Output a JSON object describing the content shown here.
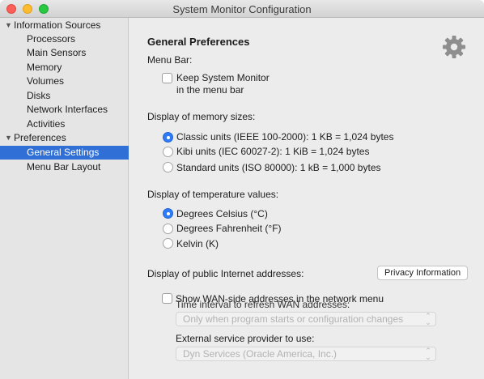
{
  "window": {
    "title": "System Monitor Configuration"
  },
  "sidebar": {
    "groups": [
      {
        "label": "Information Sources",
        "items": [
          "Processors",
          "Main Sensors",
          "Memory",
          "Volumes",
          "Disks",
          "Network Interfaces",
          "Activities"
        ]
      },
      {
        "label": "Preferences",
        "items": [
          "General Settings",
          "Menu Bar Layout"
        ]
      }
    ],
    "selected": "General Settings",
    "disclosure_icon": "disclosure-triangle-down"
  },
  "content": {
    "heading": "General Preferences",
    "settings_icon": "gear-icon",
    "menu_bar": {
      "label": "Menu Bar:",
      "checkbox_line1": "Keep System Monitor",
      "checkbox_line2": "in the menu bar",
      "checked": false
    },
    "memory_sizes": {
      "label": "Display of memory sizes:",
      "options": [
        "Classic units (IEEE 100-2000): 1 KB = 1,024 bytes",
        "Kibi units (IEC 60027-2): 1 KiB = 1,024 bytes",
        "Standard units (ISO 80000): 1 kB = 1,000 bytes"
      ],
      "selected_index": 0
    },
    "temperature": {
      "label": "Display of temperature values:",
      "options": [
        "Degrees Celsius (°C)",
        "Degrees Fahrenheit (°F)",
        "Kelvin (K)"
      ],
      "selected_index": 0
    },
    "internet": {
      "label": "Display of public Internet addresses:",
      "privacy_button": "Privacy Information",
      "wan_checkbox": "Show WAN-side addresses in the network menu",
      "wan_checked": false,
      "interval_label": "Time interval to refresh WAN addresses:",
      "interval_value": "Only when program starts or configuration changes",
      "provider_label": "External service provider to use:",
      "provider_value": "Dyn Services (Oracle America, Inc.)"
    }
  },
  "colors": {
    "selection": "#2f6fd6",
    "radio_on": "#2f7bf6",
    "sidebar_bg": "#e5e5e5",
    "content_bg": "#ececec"
  }
}
